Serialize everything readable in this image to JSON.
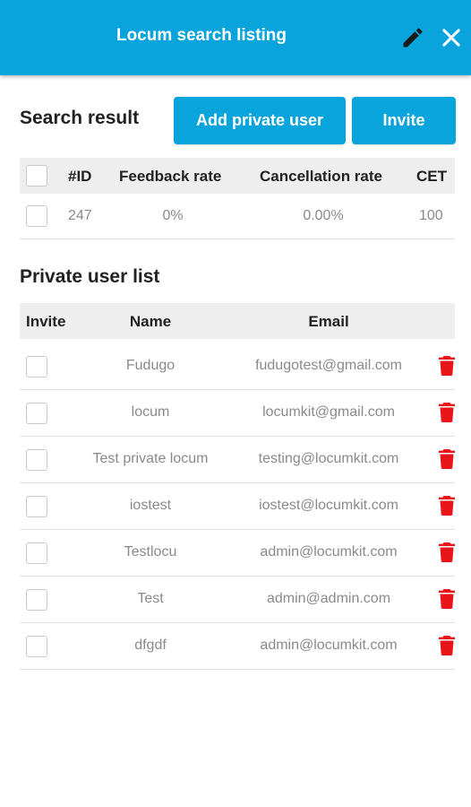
{
  "header": {
    "title": "Locum search listing",
    "bg_color": "#0aa4dc"
  },
  "search_result": {
    "title": "Search result",
    "add_button_label": "Add private user",
    "invite_button_label": "Invite",
    "columns": [
      "#ID",
      "Feedback rate",
      "Cancellation rate",
      "CET"
    ],
    "row": {
      "id": "247",
      "feedback_rate": "0%",
      "cancellation_rate": "0.00%",
      "cet": "100"
    }
  },
  "private_users": {
    "title": "Private user list",
    "columns": [
      "Invite",
      "Name",
      "Email"
    ],
    "rows": [
      {
        "name": "Fudugo",
        "email": "fudugotest@gmail.com"
      },
      {
        "name": "locum",
        "email": "locumkit@gmail.com"
      },
      {
        "name": "Test private locum",
        "email": "testing@locumkit.com"
      },
      {
        "name": "iostest",
        "email": "iostest@locumkit.com"
      },
      {
        "name": "Testlocu",
        "email": "admin@locumkit.com"
      },
      {
        "name": "Test",
        "email": "admin@admin.com"
      },
      {
        "name": "dfgdf",
        "email": "admin@locumkit.com"
      }
    ],
    "delete_icon_color": "#e8151b"
  }
}
